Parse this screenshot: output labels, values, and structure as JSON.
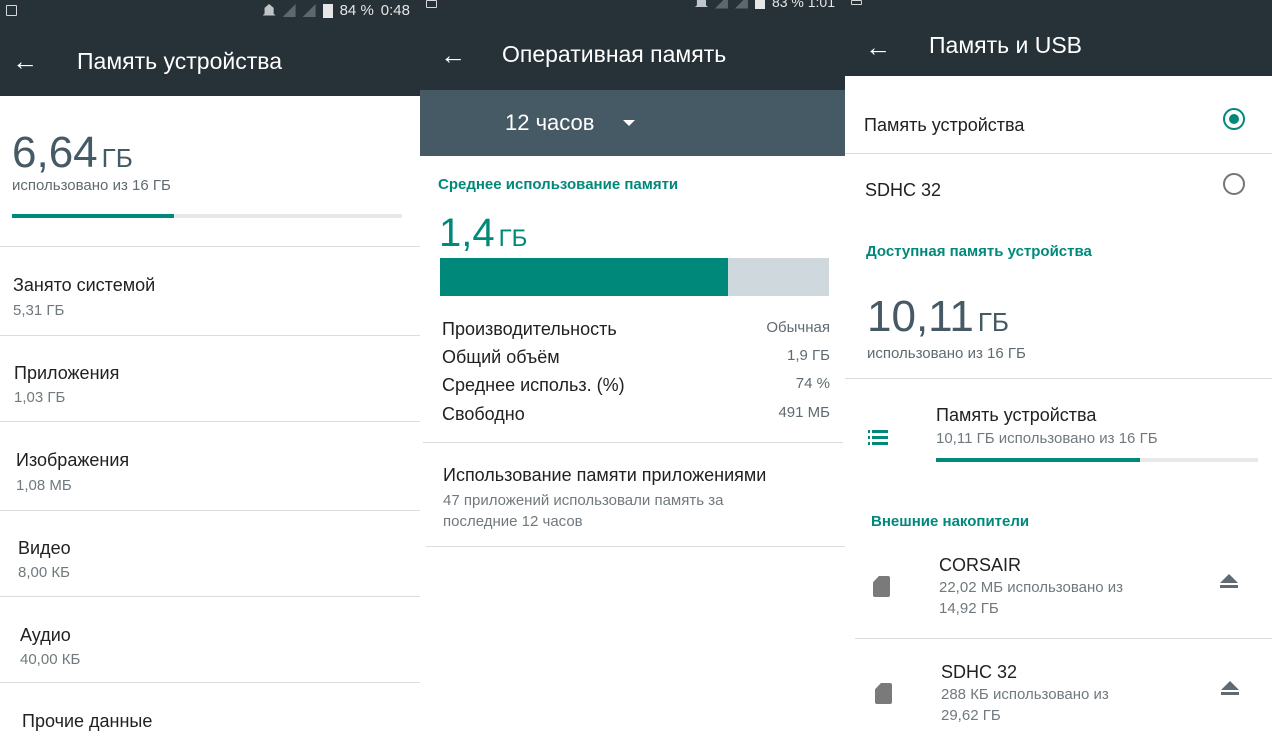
{
  "panel1": {
    "status": {
      "battery": "84 %",
      "time": "0:48"
    },
    "title": "Память устройства",
    "used": {
      "value": "6,64",
      "unit": "ГБ",
      "caption": "использовано из 16 ГБ",
      "fraction": 0.415
    },
    "items": [
      {
        "label": "Занято системой",
        "value": "5,31 ГБ"
      },
      {
        "label": "Приложения",
        "value": "1,03 ГБ"
      },
      {
        "label": "Изображения",
        "value": "1,08 МБ"
      },
      {
        "label": "Видео",
        "value": "8,00 КБ"
      },
      {
        "label": "Аудио",
        "value": "40,00 КБ"
      },
      {
        "label": "Прочие данные",
        "value": ""
      }
    ]
  },
  "panel2": {
    "status": {
      "text": "83 % 1:01"
    },
    "title": "Оперативная память",
    "filter": {
      "selected": "12 часов"
    },
    "section_title": "Среднее использование памяти",
    "average": {
      "value": "1,4",
      "unit": "ГБ",
      "fraction": 0.74
    },
    "stats": [
      {
        "label": "Производительность",
        "value": "Обычная"
      },
      {
        "label": "Общий объём",
        "value": "1,9 ГБ"
      },
      {
        "label": "Среднее использ. (%)",
        "value": "74 %"
      },
      {
        "label": "Свободно",
        "value": "491 МБ"
      }
    ],
    "apps": {
      "title": "Использование памяти приложениями",
      "line1": "47 приложений использовали память за",
      "line2": "последние 12 часов"
    }
  },
  "panel3": {
    "title": "Память и USB",
    "options": [
      {
        "label": "Память устройства",
        "selected": true
      },
      {
        "label": "SDHC 32",
        "selected": false
      }
    ],
    "available_title": "Доступная память устройства",
    "available": {
      "value": "10,11",
      "unit": "ГБ",
      "caption": "использовано из 16 ГБ"
    },
    "device_storage": {
      "name": "Память устройства",
      "usage": "10,11 ГБ использовано из 16 ГБ",
      "fraction": 0.632
    },
    "external_title": "Внешние накопители",
    "external": [
      {
        "name": "CORSAIR",
        "line1": "22,02 МБ использовано из",
        "line2": "14,92 ГБ"
      },
      {
        "name": "SDHC 32",
        "line1": "288 КБ использовано из",
        "line2": "29,62 ГБ"
      }
    ]
  },
  "colors": {
    "toolbar": "#263238",
    "filterbar": "#455a64",
    "accent": "#00897b",
    "track": "#cfd8dc"
  }
}
